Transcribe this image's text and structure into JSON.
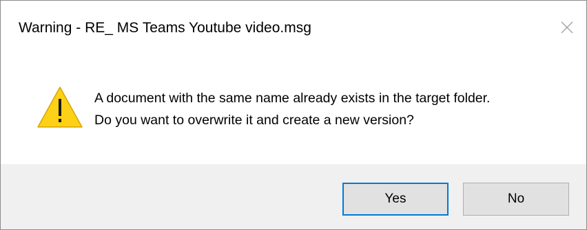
{
  "dialog": {
    "title": "Warning - RE_ MS Teams Youtube video.msg",
    "icon": "warning-icon",
    "message_line1": "A document with the same name already exists in the target folder.",
    "message_line2": "Do you want to overwrite it and create a new version?",
    "buttons": {
      "yes_label": "Yes",
      "no_label": "No"
    },
    "colors": {
      "warning_yellow": "#FCD116",
      "focus_border": "#0078D7",
      "footer_bg": "#F0F0F0"
    }
  }
}
